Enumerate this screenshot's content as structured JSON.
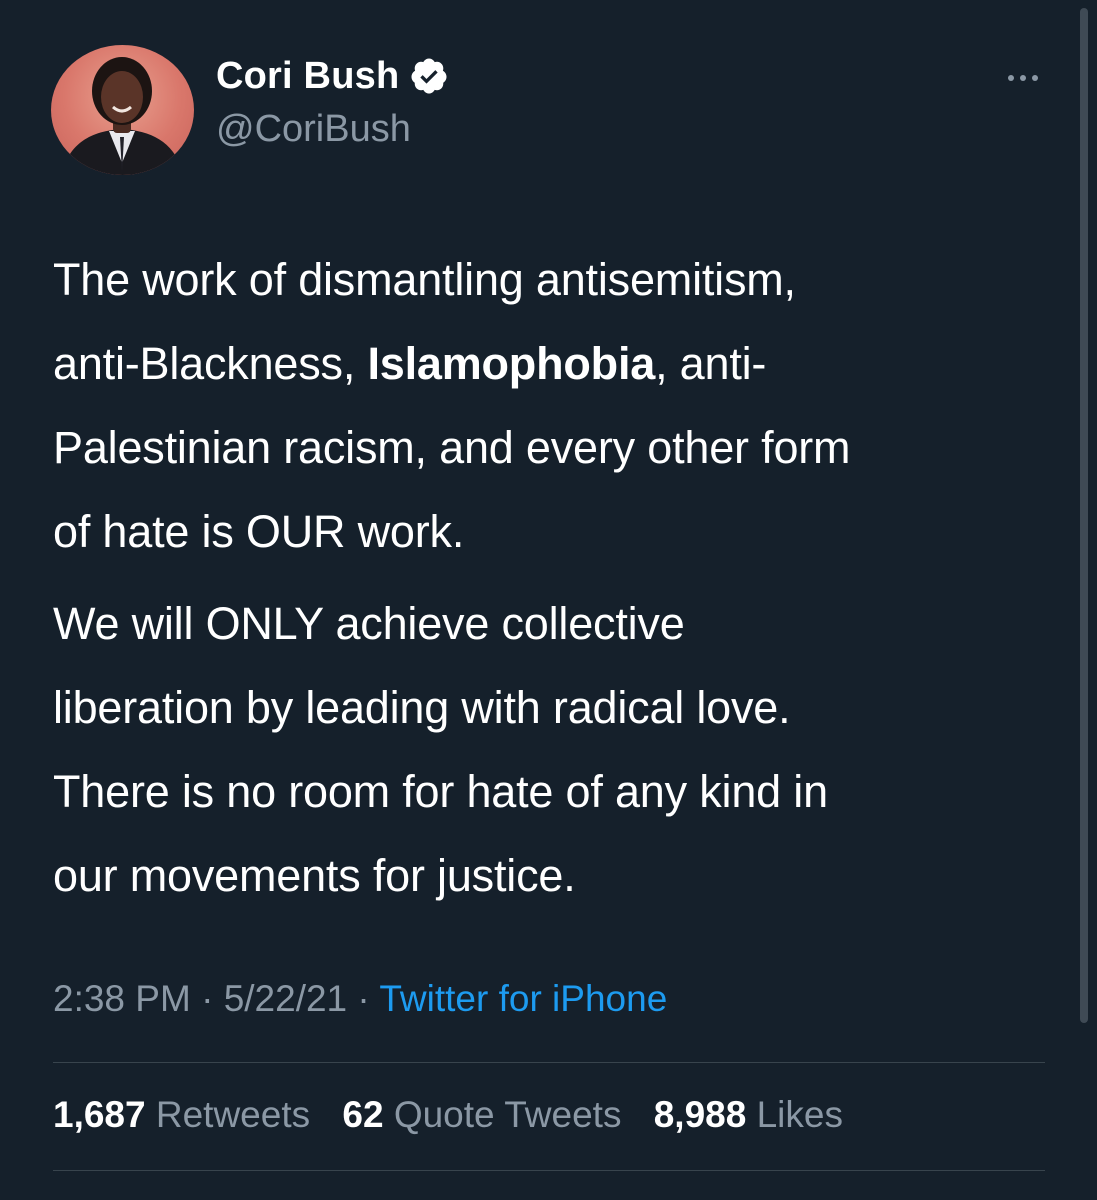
{
  "user": {
    "display_name": "Cori Bush",
    "handle": "@CoriBush",
    "verified_icon": "verified-badge-icon"
  },
  "tweet": {
    "lines_p1": [
      "The work of dismantling antisemitism,",
      "anti-Blackness, ",
      "Islamophobia",
      ", anti-",
      "Palestinian racism, and every other form",
      "of hate is OUR work."
    ],
    "lines_p2": [
      "We will ONLY achieve collective",
      "liberation by leading with radical love.",
      "There is no room for hate of any kind in",
      "our movements for justice."
    ]
  },
  "meta": {
    "time": "2:38 PM",
    "sep1": " · ",
    "date": "5/22/21",
    "sep2": " · ",
    "source": "Twitter for iPhone"
  },
  "stats": {
    "retweets_count": "1,687",
    "retweets_label": "Retweets",
    "quotes_count": "62",
    "quotes_label": "Quote Tweets",
    "likes_count": "8,988",
    "likes_label": "Likes"
  },
  "colors": {
    "background": "#15202b",
    "secondary_text": "#8b98a5",
    "link": "#1d9bf0",
    "divider": "#38444d"
  }
}
